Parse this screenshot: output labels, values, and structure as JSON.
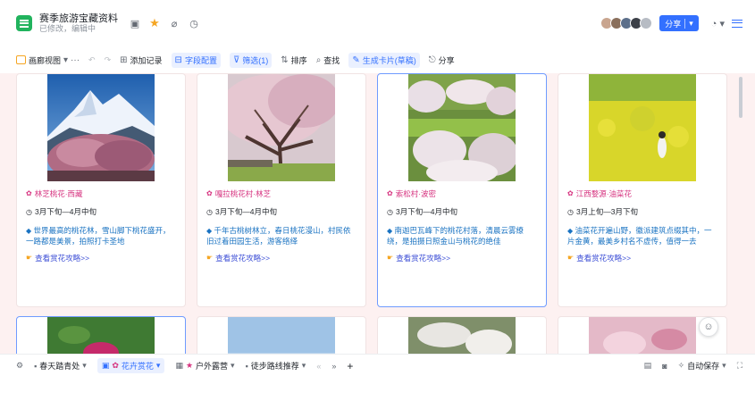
{
  "header": {
    "title": "赛季旅游宝藏资料",
    "subtitle": "已修改，编辑中"
  },
  "share": {
    "label": "分享"
  },
  "toolbar": {
    "view_label": "画廊视图",
    "add_label": "添加记录",
    "field_label": "字段配置",
    "filter_label": "筛选(1)",
    "sort_label": "排序",
    "search_label": "查找",
    "gen_label": "生成卡片(草稿)",
    "more_label": "分享"
  },
  "cards": [
    {
      "title": "林芝桃花·西藏",
      "time": "3月下旬—4月中旬",
      "desc": "世界最高的桃花林，雪山脚下桃花盛开，一路都是美景，拍照打卡圣地",
      "link": "查看赏花攻略>>"
    },
    {
      "title": "嘎拉桃花村·林芝",
      "time": "3月下旬—4月中旬",
      "desc": "千年古桃树林立，春日桃花漫山，村民依旧过着田园生活，游客络绎",
      "link": "查看赏花攻略>>"
    },
    {
      "title": "索松村·波密",
      "time": "3月下旬—4月中旬",
      "desc": "南迦巴瓦峰下的桃花村落，清晨云雾缭绕，是拍摄日照金山与桃花的绝佳",
      "link": "查看赏花攻略>>"
    },
    {
      "title": "江西婺源·油菜花",
      "time": "3月上旬—3月下旬",
      "desc": "油菜花开遍山野，徽派建筑点缀其中，一片金黄，最美乡村名不虚传，值得一去",
      "link": "查看赏花攻略>>"
    }
  ],
  "bottom": {
    "tab1": "春天踏青处",
    "tab2": "花卉赏花",
    "tab3": "户外露营",
    "tab4": "徒步路线推荐",
    "right_label": "自动保存"
  },
  "colors": {
    "accent": "#3370ff",
    "card_title": "#d6327f",
    "desc": "#1a73c2",
    "gallery_bg": "#fdf1f1"
  }
}
